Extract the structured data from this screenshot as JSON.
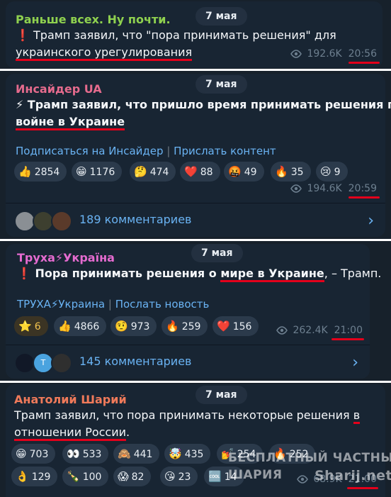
{
  "posts": [
    {
      "channel": "Раньше всех. Ну почти.",
      "channel_color": "#8fd14f",
      "date": "7 мая",
      "text_prefix": "❗ Трамп заявил, что \"пора принимать решения\" для",
      "text_line2": "украинского урегулирования",
      "views": "192.6K",
      "time": "20:56"
    },
    {
      "channel": "Инсайдер UA",
      "channel_color": "#e56b8d",
      "date": "7 мая",
      "text_line1": "⚡ Трамп заявил, что пришло время принимать решения по",
      "text_line2": "войне в Украине",
      "links": [
        "Подписаться на Инсайдер",
        "|",
        "Прислать контент"
      ],
      "reactions": [
        {
          "icon": "👍",
          "count": "2854"
        },
        {
          "icon": "😁",
          "count": "1176"
        },
        {
          "icon": "🤔",
          "count": "474"
        },
        {
          "icon": "❤️",
          "count": "88"
        },
        {
          "icon": "🤬",
          "count": "49"
        },
        {
          "icon": "🔥",
          "count": "35"
        },
        {
          "icon": "😢",
          "count": "9"
        }
      ],
      "views": "194.6K",
      "time": "20:59",
      "comments": "189 комментариев"
    },
    {
      "channel": "Труха⚡Україна",
      "channel_color": "#e56bd0",
      "date": "7 мая",
      "text_a": "❗ Пора принимать решения о ",
      "text_b": "мире в Украине",
      "text_c": ", – Трамп.",
      "links": [
        "ТРУХА⚡Украина",
        "|",
        "Послать новость"
      ],
      "reactions": [
        {
          "icon": "⭐",
          "count": "6",
          "gold": true
        },
        {
          "icon": "👍",
          "count": "4866"
        },
        {
          "icon": "🤨",
          "count": "973"
        },
        {
          "icon": "🔥",
          "count": "259"
        },
        {
          "icon": "❤️",
          "count": "156"
        }
      ],
      "views": "262.4K",
      "time": "21:00",
      "comments": "145 комментариев",
      "avatar_letter": "Т"
    },
    {
      "channel": "Анатолий Шарий",
      "channel_color": "#f07a5a",
      "date": "7 мая",
      "text_line1a": "Трамп заявил, что пора принимать некоторые решения ",
      "text_line1b": "в",
      "text_line2": "отношении России",
      "text_line2_end": ".",
      "reactions_row1": [
        {
          "icon": "😁",
          "count": "703"
        },
        {
          "icon": "👀",
          "count": "533"
        },
        {
          "icon": "🙈",
          "count": "441"
        },
        {
          "icon": "🤯",
          "count": "435"
        },
        {
          "icon": "💅",
          "count": "254"
        },
        {
          "icon": "🔥",
          "count": "252"
        }
      ],
      "reactions_row2": [
        {
          "icon": "👌",
          "count": "129"
        },
        {
          "icon": "🍾",
          "count": "100"
        },
        {
          "icon": "😱",
          "count": "82"
        },
        {
          "icon": "😘",
          "count": "23"
        },
        {
          "icon": "🆒",
          "count": "14"
        }
      ],
      "views": "68.9K",
      "time": "21:00"
    }
  ],
  "watermark": {
    "line1": "БЕСПЛАТНЫЙ ЧАСТНЫЙ",
    "line2": "ШАРИЯ",
    "site": "Sharij.net"
  },
  "colors": {
    "background": "#17212b",
    "bubble": "#182533",
    "link": "#6ab3f3",
    "underline": "#e3001b"
  }
}
